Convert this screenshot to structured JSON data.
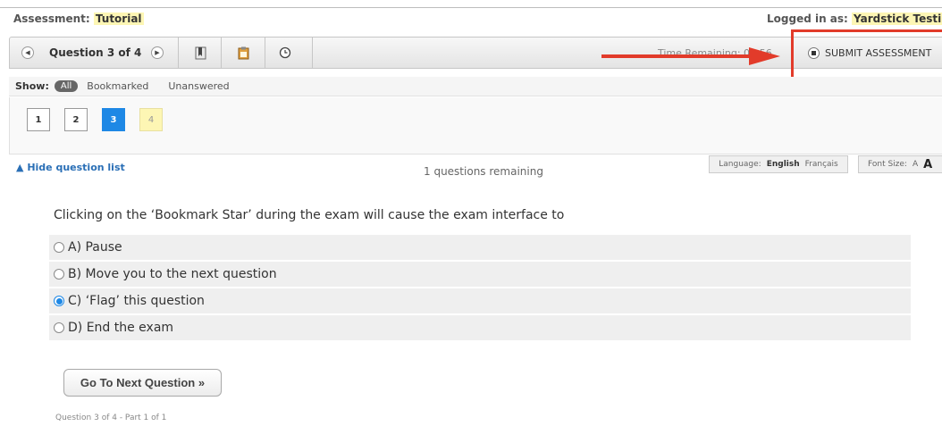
{
  "header": {
    "assessment_label": "Assessment:",
    "assessment_name": "Tutorial",
    "logged_in_label": "Logged in as:",
    "user_name": "Yardstick Testing"
  },
  "toolbar": {
    "question_position": "Question 3 of 4",
    "time_remaining": "Time Remaining: 00:56",
    "submit_label": "SUBMIT ASSESSMENT"
  },
  "filter": {
    "show_label": "Show:",
    "options": [
      "All",
      "Bookmarked",
      "Unanswered"
    ],
    "selected": "All"
  },
  "question_list": [
    {
      "number": "1",
      "state": "answered"
    },
    {
      "number": "2",
      "state": "answered"
    },
    {
      "number": "3",
      "state": "current"
    },
    {
      "number": "4",
      "state": "unanswered"
    }
  ],
  "status_bar": {
    "hide_list": "Hide question list",
    "remaining": "1 questions remaining",
    "language_label": "Language:",
    "language_selected": "English",
    "language_other": "Français",
    "font_size_label": "Font Size:",
    "font_small": "A",
    "font_large": "A"
  },
  "question": {
    "text": "Clicking on the ‘Bookmark Star’ during the exam will cause the exam interface to",
    "options": [
      {
        "label": "A) Pause",
        "selected": false
      },
      {
        "label": "B)  Move you to the next question",
        "selected": false
      },
      {
        "label": "C) ‘Flag’ this question",
        "selected": true
      },
      {
        "label": "D) End the exam",
        "selected": false
      }
    ]
  },
  "next_button": "Go To Next Question »",
  "footer": "Question 3 of 4 - Part 1 of 1",
  "colors": {
    "highlight": "#fdf6b4",
    "current_question": "#1e88e5",
    "annotation_red": "#e23b2a",
    "link": "#2a6fb6"
  }
}
